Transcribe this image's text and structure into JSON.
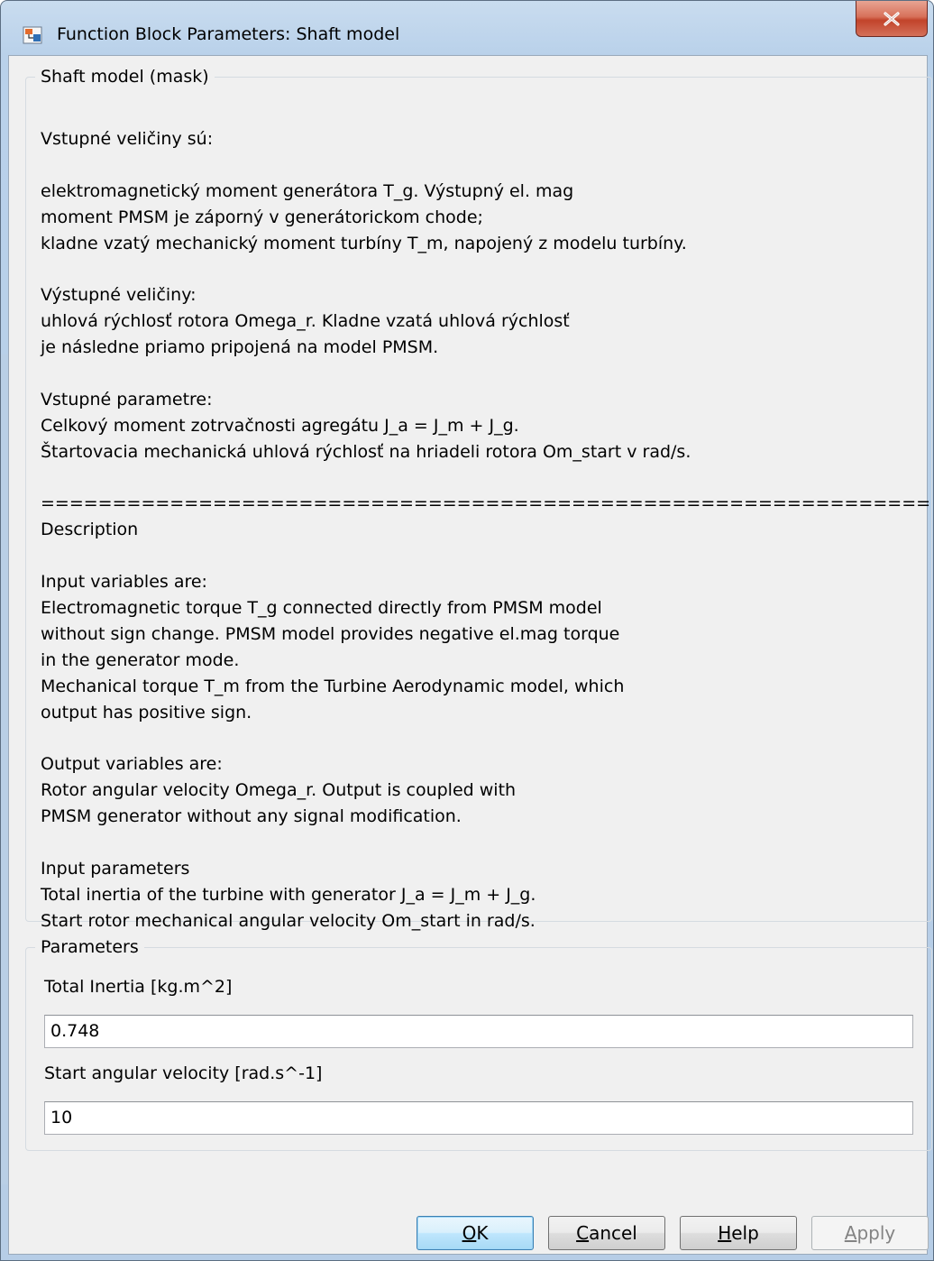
{
  "window": {
    "title": "Function Block Parameters: Shaft model",
    "icon": "simulink-block-icon",
    "close_icon": "close-icon"
  },
  "description_group": {
    "legend": "Shaft model (mask)",
    "lines": [
      "Vstupné veličiny sú:",
      "",
      "elektromagnetický moment generátora T_g. Výstupný el. mag",
      "moment PMSM je záporný v generátorickom chode;",
      "kladne vzatý mechanický moment turbíny T_m, napojený z modelu turbíny.",
      "",
      "Výstupné veličiny:",
      "uhlová rýchlosť rotora Omega_r. Kladne vzatá uhlová rýchlosť",
      "je následne priamo pripojená na model PMSM.",
      "",
      "Vstupné parametre:",
      "Celkový moment zotrvačnosti agregátu J_a = J_m + J_g.",
      "Štartovacia mechanická uhlová rýchlosť na hriadeli rotora Om_start v rad/s.",
      "",
      "==============================================================",
      "Description",
      "",
      "Input variables are:",
      "Electromagnetic torque T_g connected directly from PMSM model",
      "without sign change. PMSM model provides negative el.mag torque",
      "in the generator mode.",
      "Mechanical torque T_m from the Turbine Aerodynamic model, which",
      "output has positive sign.",
      "",
      "Output variables are:",
      "Rotor angular velocity Omega_r. Output is coupled with",
      "PMSM generator without any signal modification.",
      "",
      "Input parameters",
      "Total inertia of the turbine with generator J_a = J_m + J_g.",
      "Start rotor mechanical angular velocity Om_start in rad/s."
    ]
  },
  "parameters_group": {
    "legend": "Parameters",
    "total_inertia_label": "Total Inertia [kg.m^2]",
    "total_inertia_value": "0.748",
    "start_velocity_label": "Start angular velocity [rad.s^-1]",
    "start_velocity_value": "10"
  },
  "buttons": {
    "ok": {
      "mnemonic": "O",
      "rest": "K"
    },
    "cancel": {
      "mnemonic": "C",
      "rest": "ancel"
    },
    "help": {
      "mnemonic": "H",
      "rest": "elp"
    },
    "apply": {
      "mnemonic": "A",
      "rest": "pply"
    }
  }
}
